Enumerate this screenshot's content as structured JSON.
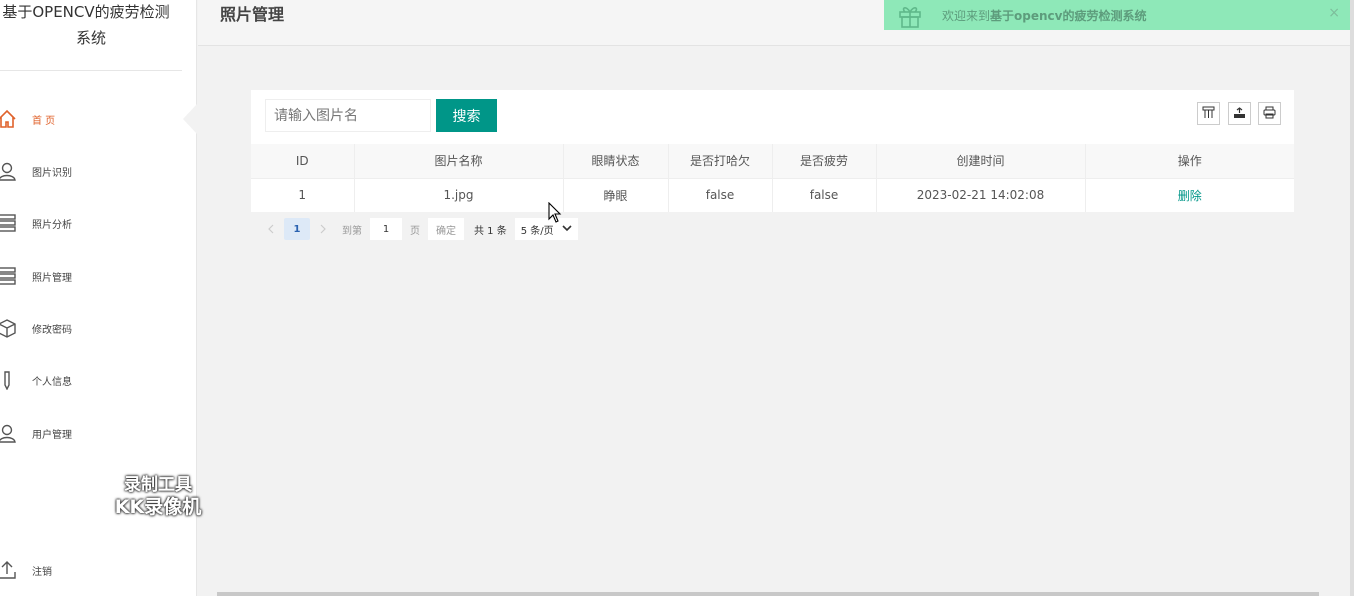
{
  "app": {
    "brand_line1": "基于OPENCV的疲劳检测",
    "brand_line2": "系统"
  },
  "sidebar": {
    "items": [
      {
        "label": "首 页",
        "icon": "home-icon",
        "active": true
      },
      {
        "label": "图片识别",
        "icon": "user-icon"
      },
      {
        "label": "照片分析",
        "icon": "list-icon"
      },
      {
        "label": "照片管理",
        "icon": "list-icon"
      },
      {
        "label": "修改密码",
        "icon": "box-icon"
      },
      {
        "label": "个人信息",
        "icon": "pencil-icon"
      },
      {
        "label": "用户管理",
        "icon": "user-icon"
      }
    ],
    "logout_label": "注销"
  },
  "watermark": {
    "line1": "录制工具",
    "line2": "KK录像机"
  },
  "header": {
    "title": "照片管理"
  },
  "notice": {
    "prefix": "欢迎来到",
    "system_name": "基于opencv的疲劳检测系统",
    "close": "×"
  },
  "search": {
    "placeholder": "请输入图片名",
    "value": "",
    "button_label": "搜索"
  },
  "toolbar": {
    "icons": [
      "columns-icon",
      "export-icon",
      "print-icon"
    ]
  },
  "table": {
    "columns": [
      "ID",
      "图片名称",
      "眼睛状态",
      "是否打哈欠",
      "是否疲劳",
      "创建时间",
      "操作"
    ],
    "rows": [
      {
        "id": "1",
        "name": "1.jpg",
        "eye_state": "睁眼",
        "yawn": "false",
        "fatigue": "false",
        "created": "2023-02-21 14:02:08",
        "action": "删除"
      }
    ]
  },
  "pagination": {
    "current_page": "1",
    "goto_prefix": "到第",
    "goto_value": "1",
    "goto_suffix": "页",
    "confirm": "确定",
    "total": "共 1 条",
    "page_size": "5 条/页"
  },
  "colors": {
    "accent": "#009688",
    "notice_bg": "#8ee8b8",
    "active_nav": "#e0622b"
  }
}
